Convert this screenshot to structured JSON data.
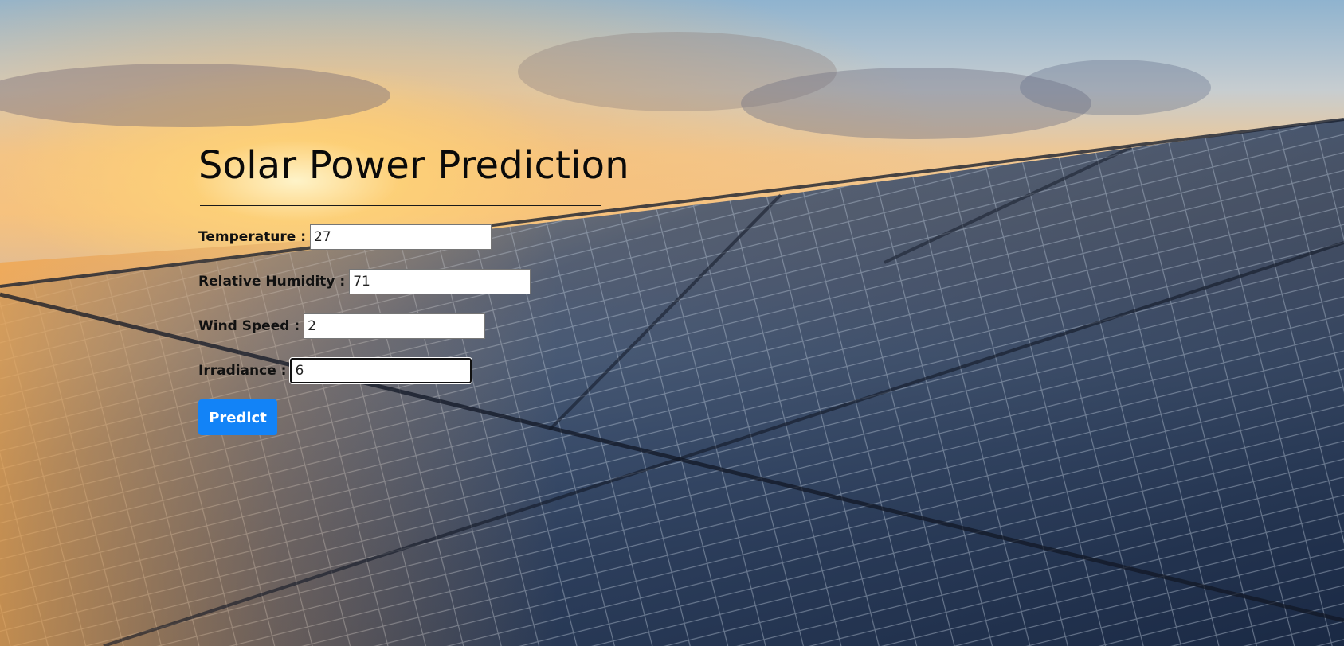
{
  "page": {
    "title": "Solar Power Prediction"
  },
  "form": {
    "fields": [
      {
        "label": "Temperature :",
        "value": "27"
      },
      {
        "label": "Relative Humidity :",
        "value": "71"
      },
      {
        "label": "Wind Speed :",
        "value": "2"
      },
      {
        "label": "Irradiance :",
        "value": "6"
      }
    ],
    "submit_label": "Predict"
  },
  "colors": {
    "button": "#1283f7",
    "heading": "#0a0a0a"
  },
  "background": {
    "image": "solar-panels-at-sunset"
  }
}
